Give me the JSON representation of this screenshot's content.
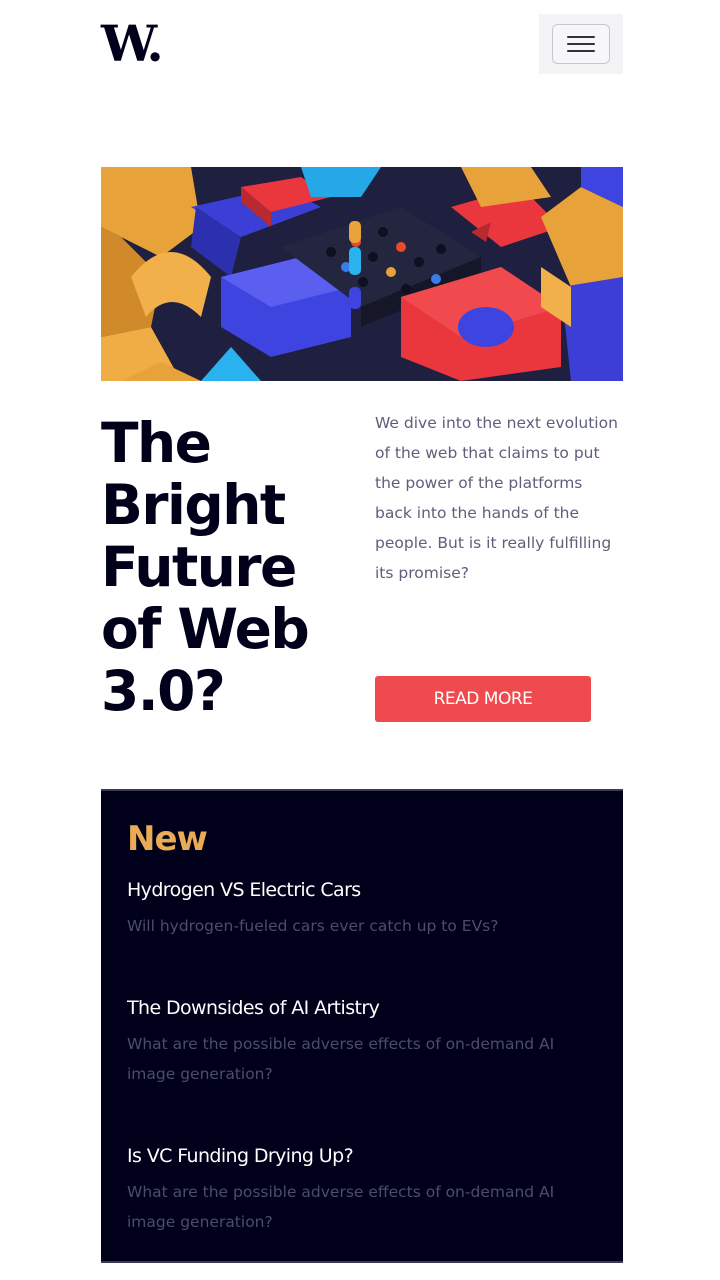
{
  "header": {
    "logo_text": "W."
  },
  "hero": {
    "image_alt": "Colorful 3D geometric blocks"
  },
  "article": {
    "headline": "The Bright Future of Web 3.0?",
    "intro": "We dive into the next evolution of the web that claims to put the power of the platforms back into the hands of the people. But is it really fulfilling its promise?",
    "cta_label": "READ MORE"
  },
  "new_section": {
    "title": "New",
    "items": [
      {
        "title": "Hydrogen VS Electric Cars",
        "description": "Will hydrogen-fueled cars ever catch up to EVs?"
      },
      {
        "title": "The Downsides of AI Artistry",
        "description": "What are the possible adverse effects of on-demand AI image generation?"
      },
      {
        "title": "Is VC Funding Drying Up?",
        "description": "What are the possible adverse effects of on-demand AI image generation?"
      }
    ]
  },
  "colors": {
    "dark_navy": "#00001a",
    "accent_red": "#f04a4e",
    "accent_orange": "#e9ab53",
    "muted_text": "#5e607a"
  }
}
